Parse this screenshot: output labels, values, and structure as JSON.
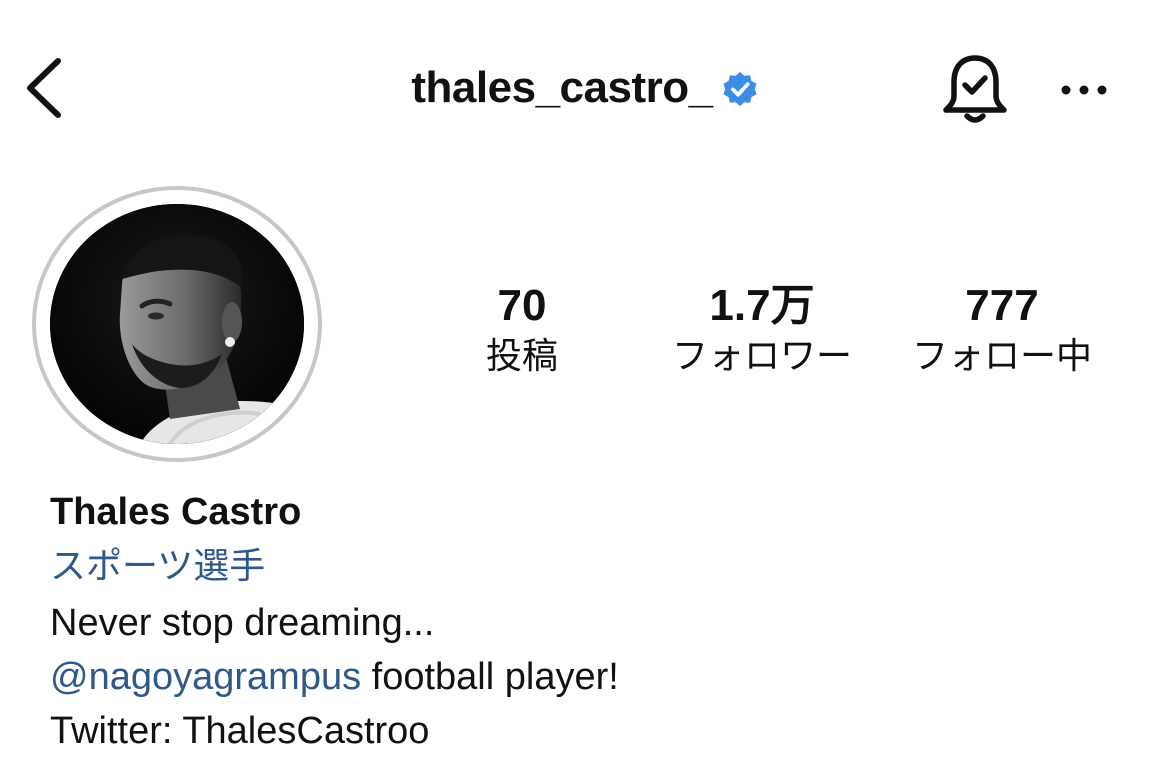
{
  "header": {
    "username": "thales_castro_",
    "verified_color": "#3b8de8",
    "icons": {
      "back": "chevron-left-icon",
      "verified": "verified-badge-icon",
      "bell": "bell-check-icon",
      "more": "more-horizontal-icon"
    }
  },
  "stats": {
    "posts": {
      "value": "70",
      "label": "投稿"
    },
    "followers": {
      "value": "1.7万",
      "label": "フォロワー"
    },
    "following": {
      "value": "777",
      "label": "フォロー中"
    }
  },
  "bio": {
    "name": "Thales Castro",
    "category": "スポーツ選手",
    "line1": "Never stop dreaming...",
    "mention": "@nagoyagrampus",
    "line2_rest": " football player!",
    "line3": "Twitter: ThalesCastroo"
  },
  "colors": {
    "link": "#30598a",
    "ring": "#c7c7c7",
    "text": "#111111"
  }
}
